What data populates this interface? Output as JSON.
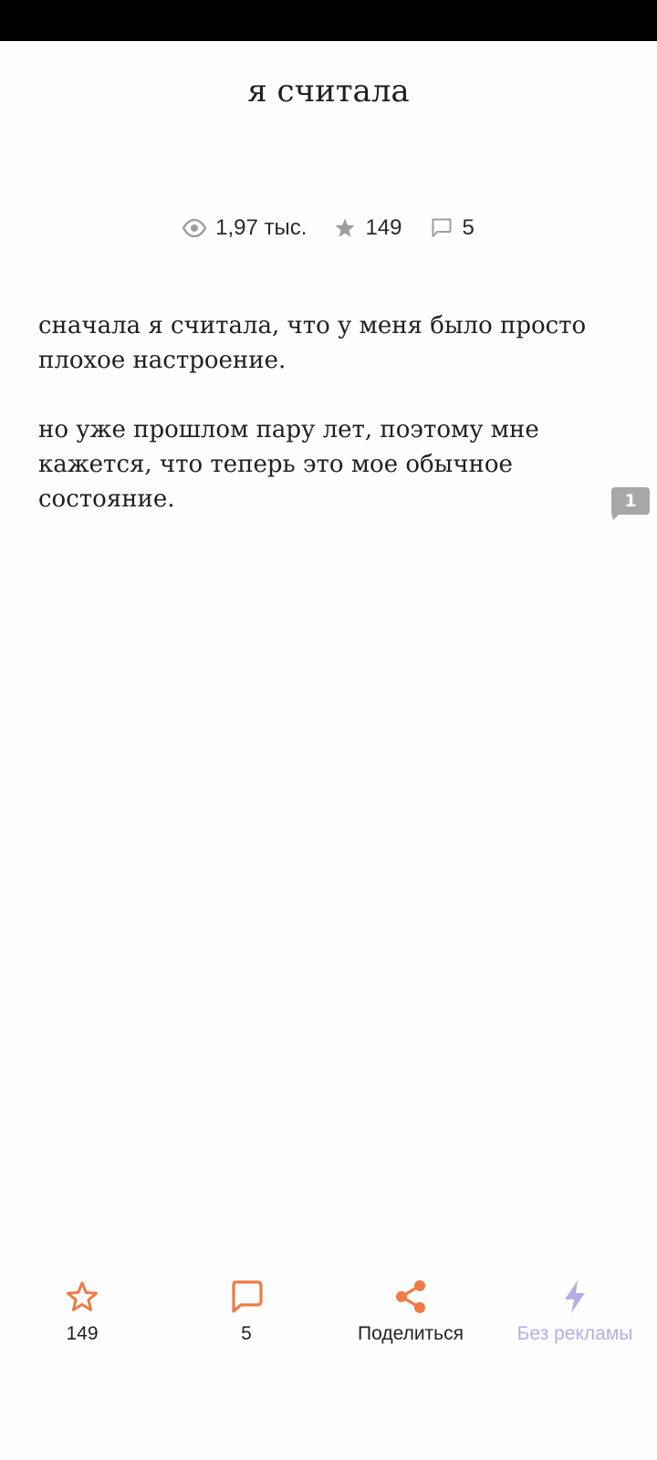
{
  "post": {
    "title": "я считала",
    "stats": {
      "views": "1,97 тыс.",
      "stars": "149",
      "comments": "5"
    },
    "paragraphs": [
      "сначала я считала, что у меня было просто плохое настроение.",
      "но уже прошлом пару лет, поэтому мне кажется, что теперь это мое обычное состояние."
    ],
    "paragraph_comment_count": "1"
  },
  "bottom_bar": {
    "star_count": "149",
    "comment_count": "5",
    "share_label": "Поделиться",
    "no_ads_label": "Без рекламы"
  },
  "colors": {
    "accent": "#ef7a45",
    "no_ads": "#b6aee3",
    "stat_icon": "#9e9e9e",
    "bubble": "#a7a7a7"
  },
  "icons": [
    "eye-icon",
    "star-icon",
    "comment-icon",
    "share-icon",
    "lightning-icon"
  ]
}
